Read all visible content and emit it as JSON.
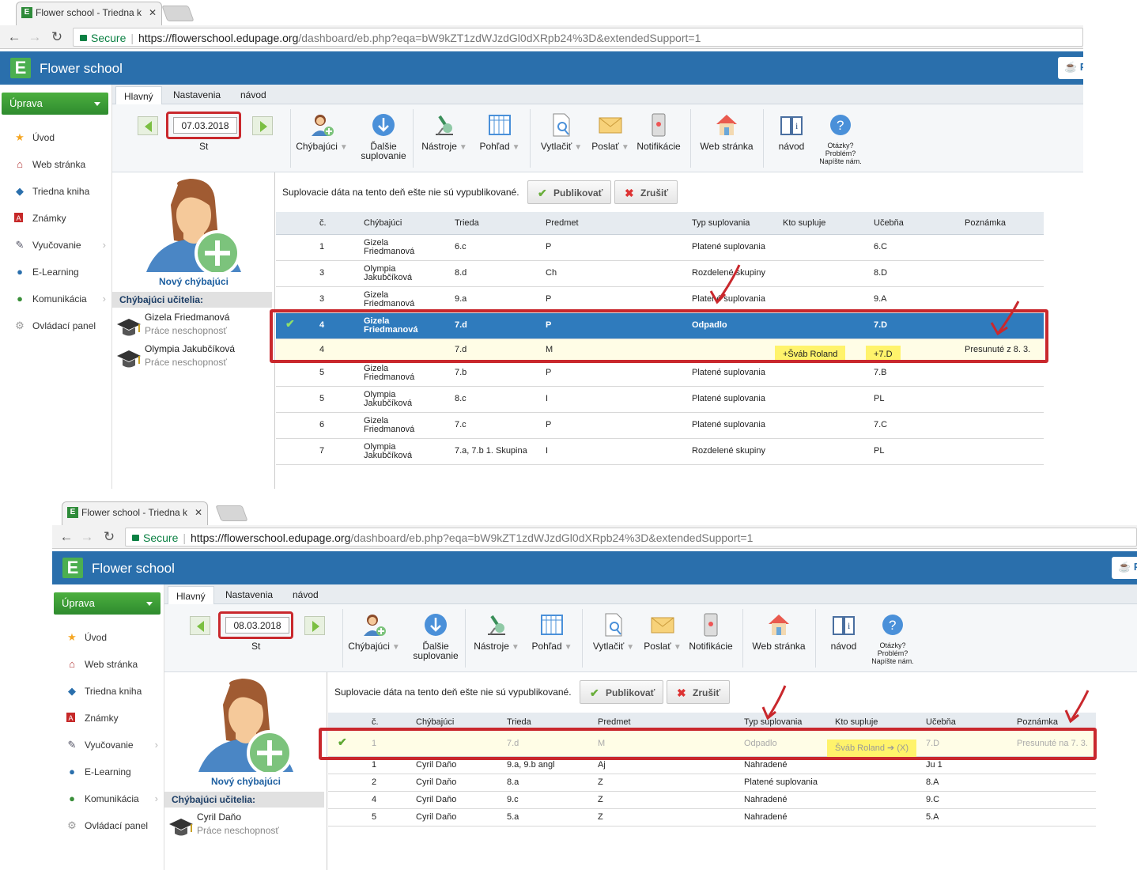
{
  "shot1": {
    "tab_title": "Flower school - Triedna k",
    "secure": "Secure",
    "url_host": "https://flowerschool.edupage.org",
    "url_path": "/dashboard/eb.php?eqa=bW9kZT1zdWJzdGl0dXRpb24%3D&extendedSupport=1",
    "app_name": "Flower school",
    "top_right": "P",
    "edit_btn": "Úprava",
    "menu": [
      "Úvod",
      "Web stránka",
      "Triedna kniha",
      "Známky",
      "Vyučovanie",
      "E-Learning",
      "Komunikácia",
      "Ovládací panel"
    ],
    "ribbon_tabs": [
      "Hlavný",
      "Nastavenia",
      "návod"
    ],
    "date": "07.03.2018",
    "day": "St",
    "tools": {
      "absent": "Chýbajúci",
      "next": "Ďalšie suplovanie",
      "tools": "Nástroje",
      "view": "Pohľad",
      "print": "Vytlačiť",
      "send": "Poslať",
      "notif": "Notifikácie",
      "web": "Web stránka",
      "guide": "návod",
      "help": "Otázky? Problém? Napíšte nám."
    },
    "new_absent": "Nový chýbajúci",
    "absent_head": "Chýbajúci učitelia:",
    "teachers": [
      {
        "name": "Gizela Friedmanová",
        "reason": "Práce neschopnosť"
      },
      {
        "name": "Olympia Jakubčíková",
        "reason": "Práce neschopnosť"
      }
    ],
    "notice": "Suplovacie dáta na tento deň ešte nie sú vypublikované.",
    "publish": "Publikovať",
    "cancel": "Zrušiť",
    "headers": [
      "č.",
      "Chýbajúci",
      "Trieda",
      "Predmet",
      "Typ suplovania",
      "Kto supluje",
      "Učebňa",
      "Poznámka"
    ],
    "rows": [
      {
        "n": "1",
        "a": "Gizela",
        "b": "Friedmanová",
        "cls": "6.c",
        "subj": "P",
        "type": "Platené suplovania",
        "who": "",
        "room": "6.C",
        "note": ""
      },
      {
        "n": "3",
        "a": "Olympia",
        "b": "Jakubčíková",
        "cls": "8.d",
        "subj": "Ch",
        "type": "Rozdelené skupiny",
        "who": "",
        "room": "8.D",
        "note": ""
      },
      {
        "n": "3",
        "a": "Gizela",
        "b": "Friedmanová",
        "cls": "9.a",
        "subj": "P",
        "type": "Platené suplovania",
        "who": "",
        "room": "9.A",
        "note": ""
      },
      {
        "n": "4",
        "a": "Gizela",
        "b": "Friedmanová",
        "cls": "7.d",
        "subj": "P",
        "type": "Odpadlo",
        "who": "",
        "room": "7.D",
        "note": ""
      },
      {
        "n": "4",
        "a": "",
        "b": "",
        "cls": "7.d",
        "subj": "M",
        "type": "",
        "who": "+Šváb Roland",
        "room": "+7.D",
        "note": "Presunuté z 8. 3."
      },
      {
        "n": "5",
        "a": "Gizela",
        "b": "Friedmanová",
        "cls": "7.b",
        "subj": "P",
        "type": "Platené suplovania",
        "who": "",
        "room": "7.B",
        "note": ""
      },
      {
        "n": "5",
        "a": "Olympia",
        "b": "Jakubčíková",
        "cls": "8.c",
        "subj": "I",
        "type": "Platené suplovania",
        "who": "",
        "room": "PL",
        "note": ""
      },
      {
        "n": "6",
        "a": "Gizela",
        "b": "Friedmanová",
        "cls": "7.c",
        "subj": "P",
        "type": "Platené suplovania",
        "who": "",
        "room": "7.C",
        "note": ""
      },
      {
        "n": "7",
        "a": "Olympia",
        "b": "Jakubčíková",
        "cls": "7.a, 7.b 1. Skupina",
        "subj": "I",
        "type": "Rozdelené skupiny",
        "who": "",
        "room": "PL",
        "note": ""
      }
    ]
  },
  "shot2": {
    "tab_title": "Flower school - Triedna k",
    "secure": "Secure",
    "url_host": "https://flowerschool.edupage.org",
    "url_path": "/dashboard/eb.php?eqa=bW9kZT1zdWJzdGl0dXRpb24%3D&extendedSupport=1",
    "app_name": "Flower school",
    "top_right": "P",
    "edit_btn": "Úprava",
    "menu": [
      "Úvod",
      "Web stránka",
      "Triedna kniha",
      "Známky",
      "Vyučovanie",
      "E-Learning",
      "Komunikácia",
      "Ovládací panel"
    ],
    "ribbon_tabs": [
      "Hlavný",
      "Nastavenia",
      "návod"
    ],
    "date": "08.03.2018",
    "day": "St",
    "tools": {
      "absent": "Chýbajúci",
      "next": "Ďalšie suplovanie",
      "tools": "Nástroje",
      "view": "Pohľad",
      "print": "Vytlačiť",
      "send": "Poslať",
      "notif": "Notifikácie",
      "web": "Web stránka",
      "guide": "návod",
      "help": "Otázky? Problém? Napíšte nám."
    },
    "new_absent": "Nový chýbajúci",
    "absent_head": "Chýbajúci učitelia:",
    "teachers": [
      {
        "name": "Cyril Daňo",
        "reason": "Práce neschopnosť"
      }
    ],
    "notice": "Suplovacie dáta na tento deň ešte nie sú vypublikované.",
    "publish": "Publikovať",
    "cancel": "Zrušiť",
    "headers": [
      "č.",
      "Chýbajúci",
      "Trieda",
      "Predmet",
      "Typ suplovania",
      "Kto supluje",
      "Učebňa",
      "Poznámka"
    ],
    "rows": [
      {
        "n": "1",
        "a": "",
        "cls": "7.d",
        "subj": "M",
        "type": "Odpadlo",
        "who": "Šváb Roland ➔ (X)",
        "room": "7.D",
        "note": "Presunuté na 7. 3."
      },
      {
        "n": "1",
        "a": "Cyril Daňo",
        "cls": "9.a, 9.b angl",
        "subj": "Aj",
        "type": "Nahradené",
        "who": "",
        "room": "Ju 1",
        "note": ""
      },
      {
        "n": "2",
        "a": "Cyril Daňo",
        "cls": "8.a",
        "subj": "Z",
        "type": "Platené suplovania",
        "who": "",
        "room": "8.A",
        "note": ""
      },
      {
        "n": "4",
        "a": "Cyril Daňo",
        "cls": "9.c",
        "subj": "Z",
        "type": "Nahradené",
        "who": "",
        "room": "9.C",
        "note": ""
      },
      {
        "n": "5",
        "a": "Cyril Daňo",
        "cls": "5.a",
        "subj": "Z",
        "type": "Nahradené",
        "who": "",
        "room": "5.A",
        "note": ""
      }
    ]
  }
}
